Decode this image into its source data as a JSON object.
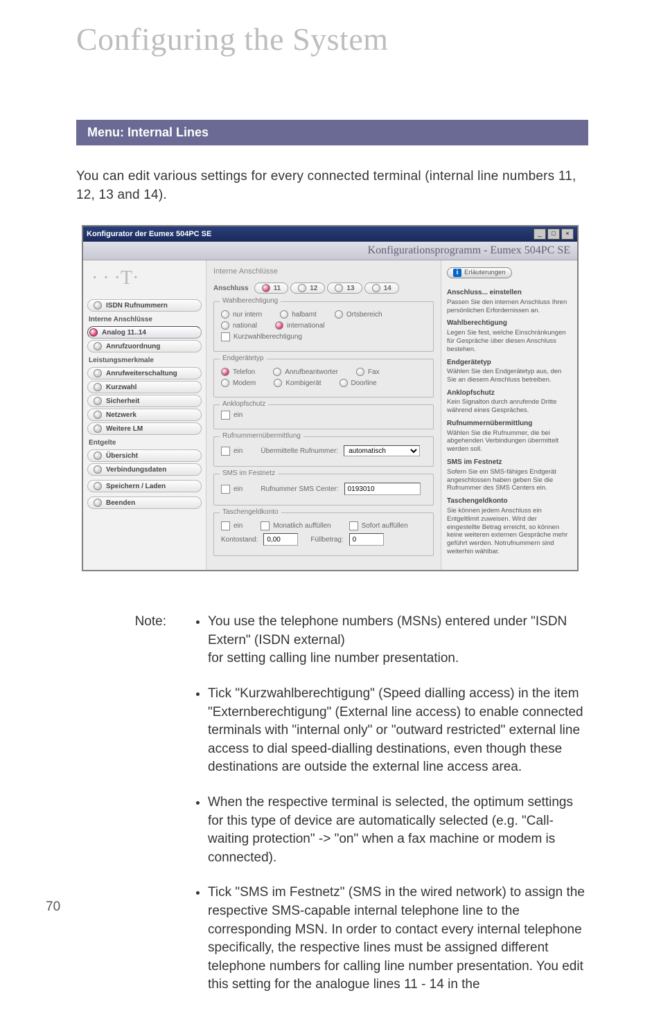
{
  "chapter_title": "Configuring the System",
  "menu_bar": "Menu: Internal Lines",
  "intro": "You can edit various settings for every connected terminal (internal line numbers 11, 12, 13 and 14).",
  "shot": {
    "titlebar": "Konfigurator der Eumex 504PC SE",
    "banner": "Konfigurationsprogramm - Eumex 504PC SE",
    "center_title": "Interne Anschlüsse",
    "anschluss_label": "Anschluss",
    "tabs": [
      "11",
      "12",
      "13",
      "14"
    ],
    "nav_items": [
      {
        "label": "ISDN Rufnummern",
        "head": ""
      },
      {
        "label": "Analog 11..14",
        "head": "Interne Anschlüsse",
        "sel": true
      },
      {
        "label": "Anrufzuordnung",
        "head": ""
      },
      {
        "label": "Anrufweiterschaltung",
        "head": "Leistungsmerkmale"
      },
      {
        "label": "Kurzwahl",
        "head": ""
      },
      {
        "label": "Sicherheit",
        "head": ""
      },
      {
        "label": "Netzwerk",
        "head": ""
      },
      {
        "label": "Weitere LM",
        "head": ""
      },
      {
        "label": "Übersicht",
        "head": "Entgelte"
      },
      {
        "label": "Verbindungsdaten",
        "head": ""
      },
      {
        "label": "Speichern / Laden",
        "head": " "
      },
      {
        "label": "Beenden",
        "head": " "
      }
    ],
    "groups": {
      "wahl": {
        "title": "Wahlberechtigung",
        "opts": [
          "nur intern",
          "halbamt",
          "Ortsbereich",
          "national",
          "international"
        ],
        "kurz": "Kurzwahlberechtigung"
      },
      "end": {
        "title": "Endgerätetyp",
        "opts": [
          "Telefon",
          "Anrufbeantworter",
          "Fax",
          "Modem",
          "Kombigerät",
          "Doorline"
        ]
      },
      "ank": {
        "title": "Anklopfschutz",
        "ein": "ein"
      },
      "ruf": {
        "title": "Rufnummernübermittlung",
        "ein": "ein",
        "lbl": "Übermittelte Rufnummer:",
        "val": "automatisch"
      },
      "sms": {
        "title": "SMS im Festnetz",
        "ein": "ein",
        "lbl": "Rufnummer SMS Center:",
        "val": "0193010"
      },
      "tgk": {
        "title": "Taschengeldkonto",
        "ein": "ein",
        "mon": "Monatlich auffüllen",
        "sof": "Sofort auffüllen",
        "konto_lbl": "Kontostand:",
        "konto": "0,00",
        "full_lbl": "Füllbetrag:",
        "full": "0"
      }
    },
    "help": {
      "btn": "Erläuterungen",
      "items": [
        {
          "h": "Anschluss... einstellen",
          "p": "Passen Sie den internen Anschluss Ihren persönlichen Erfordernissen an."
        },
        {
          "h": "Wahlberechtigung",
          "p": "Legen Sie fest, welche Einschränkungen für Gespräche über diesen Anschluss bestehen."
        },
        {
          "h": "Endgerätetyp",
          "p": "Wählen Sie den Endgerätetyp aus, den Sie an diesem Anschluss betreiben."
        },
        {
          "h": "Anklopfschutz",
          "p": "Kein Signalton durch anrufende Dritte während eines Gespräches."
        },
        {
          "h": "Rufnummernübermittlung",
          "p": "Wählen Sie die Rufnummer, die bei abgehenden Verbindungen übermittelt werden soll."
        },
        {
          "h": "SMS im Festnetz",
          "p": "Sofern Sie ein SMS-fähiges Endgerät angeschlossen haben geben Sie die Rufnummer des SMS Centers ein."
        },
        {
          "h": "Taschengeldkonto",
          "p": "Sie können jedem Anschluss ein Entgeltlimit zuweisen. Wird der eingestellte Betrag erreicht, so können keine weiteren externen Gespräche mehr geführt werden. Notrufnummern sind weiterhin wählbar."
        }
      ]
    }
  },
  "note_label": "Note:",
  "notes": [
    "You use the telephone numbers (MSNs) entered under \"ISDN Extern\" (ISDN external)\nfor setting calling line number presentation.",
    "Tick \"Kurzwahlberechtigung\" (Speed dialling access) in the item \"Externberechtigung\" (External line access) to enable connected terminals with \"internal only\" or \"outward restricted\" external line access to dial speed-dialling destinations, even though these destinations are outside the external line access area.",
    "When the respective terminal is selected, the optimum settings for this type of device are automatically selected (e.g. \"Call-waiting protection\" -> \"on\" when a fax machine or modem is connected).",
    "Tick \"SMS im Festnetz\" (SMS in the wired network) to assign the respective SMS-capable internal telephone line to the corresponding MSN. In order to contact every internal telephone specifically, the respective lines must be assigned different telephone numbers for calling line number presentation. You edit this setting for the analogue lines 11 - 14 in the"
  ],
  "page_number": "70"
}
